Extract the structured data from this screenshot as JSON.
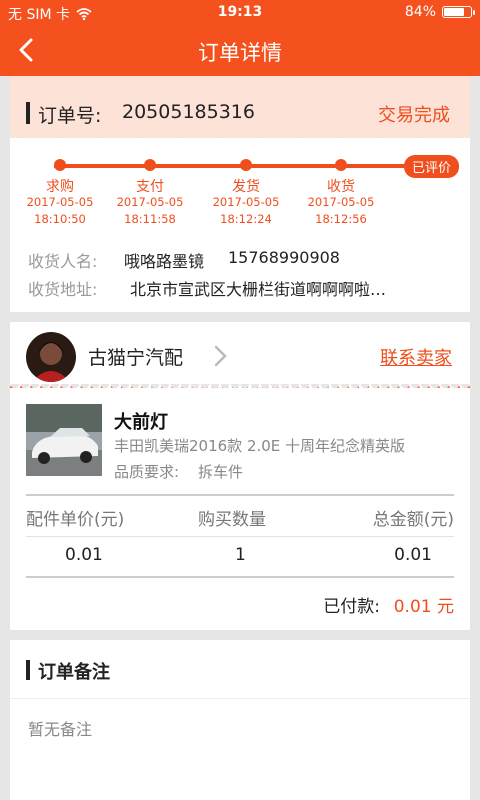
{
  "status_bar": {
    "carrier": "无 SIM 卡",
    "time": "19:13",
    "battery": "84%",
    "battery_level": 0.84
  },
  "nav": {
    "title": "订单详情"
  },
  "order": {
    "label": "订单号:",
    "number": "20505185316",
    "status": "交易完成",
    "steps": [
      {
        "name": "求购",
        "date": "2017-05-05",
        "time": "18:10:50"
      },
      {
        "name": "支付",
        "date": "2017-05-05",
        "time": "18:11:58"
      },
      {
        "name": "发货",
        "date": "2017-05-05",
        "time": "18:12:24"
      },
      {
        "name": "收货",
        "date": "2017-05-05",
        "time": "18:12:56"
      }
    ],
    "final_step": "已评价",
    "receiver_label": "收货人名:",
    "receiver_name": "哦咯路墨镜",
    "receiver_phone": "15768990908",
    "address_label": "收货地址:",
    "address": "北京市宣武区大栅栏街道啊啊啊啦…"
  },
  "shop": {
    "name": "古猫宁汽配",
    "contact": "联系卖家"
  },
  "product": {
    "name": "大前灯",
    "model": "丰田凯美瑞2016款 2.0E 十周年纪念精英版",
    "quality_label": "品质要求:",
    "quality": "拆车件",
    "table": {
      "headers": [
        "配件单价(元)",
        "购买数量",
        "总金额(元)"
      ],
      "values": [
        "0.01",
        "1",
        "0.01"
      ]
    },
    "paid_label": "已付款:",
    "paid_value": "0.01 元"
  },
  "note": {
    "title": "订单备注",
    "text": "暂无备注"
  },
  "colors": {
    "accent": "#f5511e",
    "accent_text": "#f04e1d",
    "header_bg": "#fde2d8"
  }
}
